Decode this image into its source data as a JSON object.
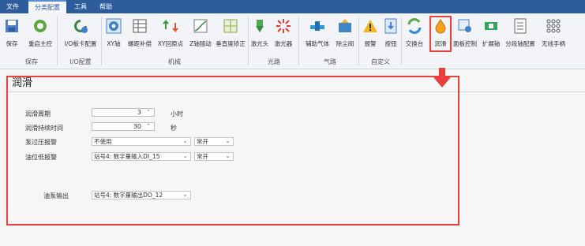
{
  "menu": [
    "文件",
    "分类配置",
    "工具",
    "帮助"
  ],
  "ribbon": {
    "buttons": [
      "保存",
      "重启主控",
      "I/O板卡配置",
      "XY轴",
      "螺距补偿",
      "XY回原点",
      "Z轴随动",
      "垂直度矫正",
      "激光头",
      "激光器",
      "辅助气体",
      "除尘阀",
      "报警",
      "按钮",
      "交换台",
      "润滑",
      "面板控制",
      "扩展轴",
      "分段轴配置",
      "无线手柄"
    ],
    "groups": [
      "保存",
      "I/O配置",
      "机械",
      "光路",
      "气路",
      "自定义"
    ]
  },
  "page": {
    "title": "润滑",
    "fields": {
      "cycle_label": "润滑周期",
      "cycle_value": "3",
      "cycle_unit": "小时",
      "duration_label": "润滑持续时间",
      "duration_value": "30",
      "duration_unit": "秒",
      "overpressure_label": "泵过压报警",
      "overpressure_value": "不使用",
      "overpressure_mode": "常开",
      "lowlevel_label": "油位低报警",
      "lowlevel_value": "站号4: 数字量输入DI_15",
      "lowlevel_mode": "常开",
      "pump_label": "油泵输出",
      "pump_value": "站号4: 数字量输出DO_12"
    }
  },
  "colors": {
    "menubar": "#2e5d9e",
    "highlight": "#e8403c"
  }
}
